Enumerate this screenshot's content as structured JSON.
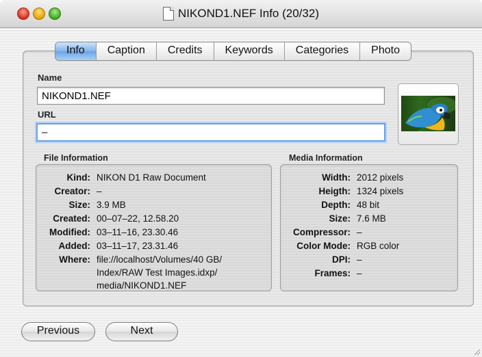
{
  "window": {
    "title": "NIKOND1.NEF Info (20/32)"
  },
  "tabs": [
    "Info",
    "Caption",
    "Credits",
    "Keywords",
    "Categories",
    "Photo"
  ],
  "selected_tab": "Info",
  "name_field": {
    "label": "Name",
    "value": "NIKOND1.NEF"
  },
  "url_field": {
    "label": "URL",
    "value": "–"
  },
  "file_info": {
    "title": "File Information",
    "rows": [
      {
        "key": "Kind:",
        "value": "NIKON D1 Raw Document"
      },
      {
        "key": "Creator:",
        "value": "–"
      },
      {
        "key": "Size:",
        "value": "3.9 MB"
      },
      {
        "key": "Created:",
        "value": "00–07–22, 12.58.20"
      },
      {
        "key": "Modified:",
        "value": "03–11–16, 23.30.46"
      },
      {
        "key": "Added:",
        "value": "03–11–17, 23.31.46"
      },
      {
        "key": "Where:",
        "value": "file://localhost/Volumes/40 GB/"
      }
    ],
    "where_cont": [
      "Index/RAW Test Images.idxp/",
      "media/NIKOND1.NEF"
    ]
  },
  "media_info": {
    "title": "Media Information",
    "rows": [
      {
        "key": "Width:",
        "value": "2012 pixels"
      },
      {
        "key": "Heigth:",
        "value": "1324 pixels"
      },
      {
        "key": "Depth:",
        "value": "48 bit"
      },
      {
        "key": "Size:",
        "value": "7.6 MB"
      },
      {
        "key": "Compressor:",
        "value": "–"
      },
      {
        "key": "Color Mode:",
        "value": "RGB color"
      },
      {
        "key": "DPI:",
        "value": "–"
      },
      {
        "key": "Frames:",
        "value": "–"
      }
    ]
  },
  "buttons": {
    "previous": "Previous",
    "next": "Next"
  },
  "icons": {
    "document": "document-icon",
    "thumbnail": "parrot-thumbnail-icon"
  }
}
